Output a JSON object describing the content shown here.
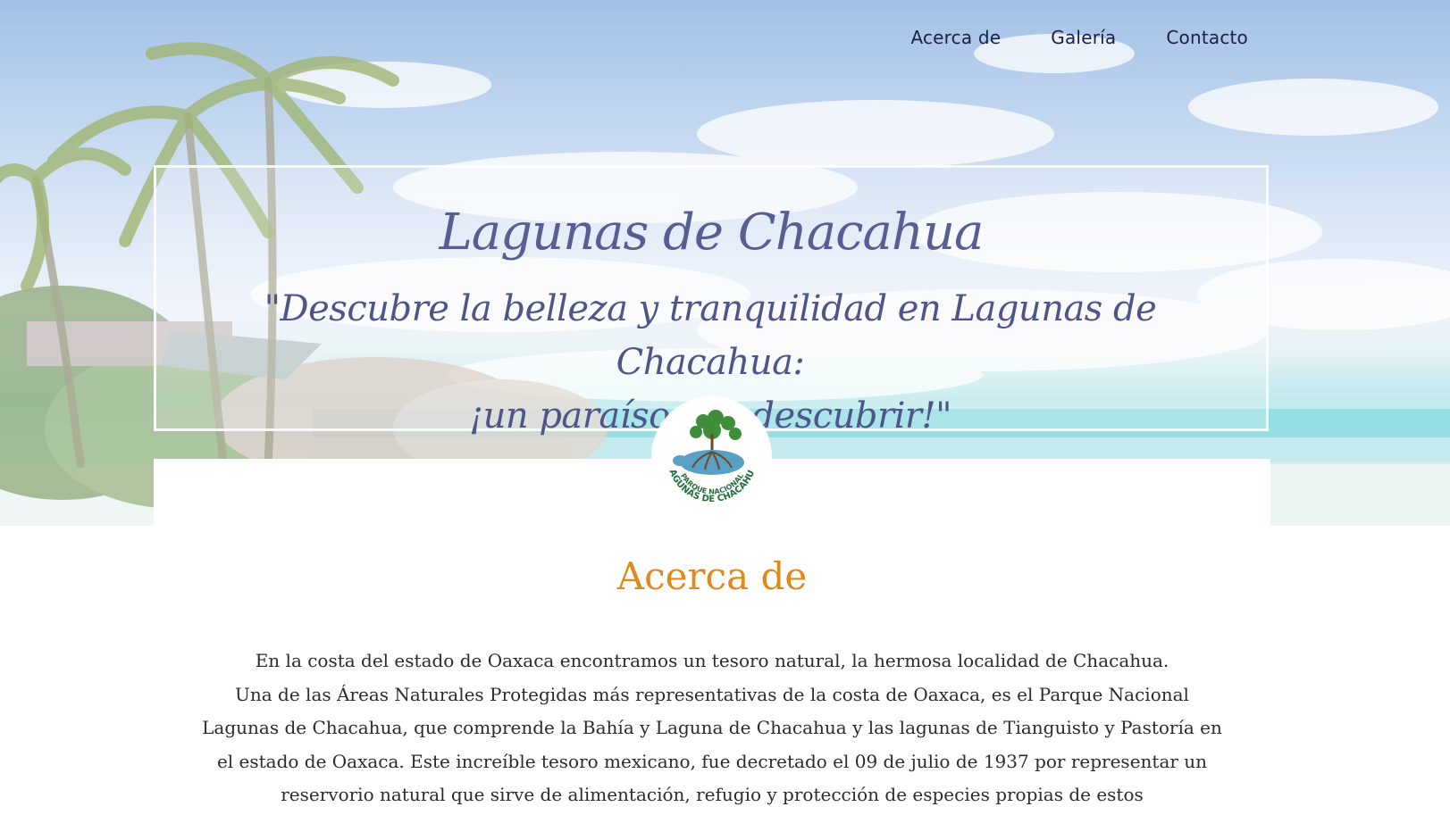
{
  "nav": {
    "items": [
      {
        "label": "Acerca de"
      },
      {
        "label": "Galería"
      },
      {
        "label": "Contacto"
      }
    ]
  },
  "hero": {
    "title": "Lagunas de Chacahua",
    "subtitle_line1": "\"Descubre la belleza y tranquilidad en Lagunas de Chacahua:",
    "subtitle_line2": "¡un paraíso por descubrir!\""
  },
  "logo": {
    "text_line1": "PARQUE NACIONAL",
    "text_line2": "LAGUNAS DE CHACAHUA"
  },
  "about": {
    "title": "Acerca de",
    "paragraph1": "En la costa del estado de Oaxaca encontramos un tesoro natural, la hermosa localidad de Chacahua.",
    "paragraph2": "Una de las Áreas Naturales Protegidas más representativas de la costa de Oaxaca, es el Parque Nacional Lagunas de Chacahua, que comprende la Bahía y Laguna de Chacahua y las lagunas de Tianguisto y Pastoría en el estado de Oaxaca. Este increíble tesoro mexicano, fue decretado el 09 de julio de 1937 por representar un reservorio natural que sirve de alimentación, refugio y protección de especies propias de estos"
  },
  "colors": {
    "nav_text": "#1b1f4a",
    "hero_title": "#575e93",
    "section_title": "#df8a1c",
    "body_text": "#2b2b2b"
  }
}
